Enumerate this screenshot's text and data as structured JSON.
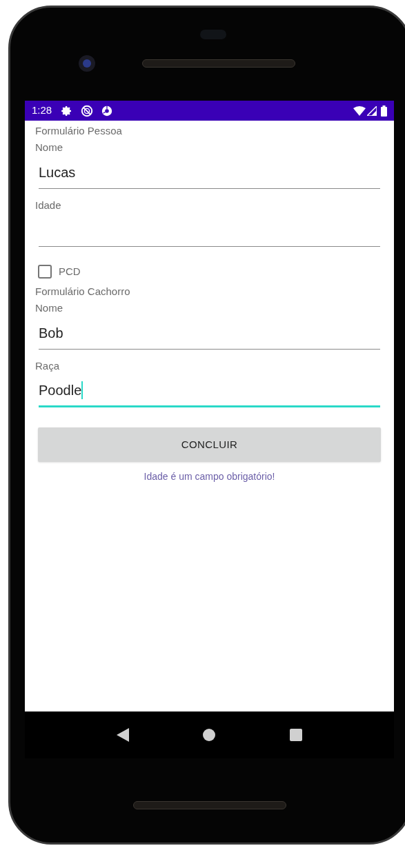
{
  "status_bar": {
    "time": "1:28"
  },
  "content": [
    {
      "kind": "heading",
      "text": "Formulário Pessoa"
    },
    {
      "kind": "label",
      "text": "Nome"
    },
    {
      "kind": "field",
      "value": "Lucas",
      "focused": false
    },
    {
      "kind": "label",
      "text": "Idade"
    },
    {
      "kind": "field",
      "focused": false
    },
    {
      "kind": "checkbox",
      "label": "PCD",
      "checked": false
    },
    {
      "kind": "heading",
      "text": "Formulário Cachorro"
    },
    {
      "kind": "label",
      "text": "Nome"
    },
    {
      "kind": "field",
      "value": "Bob",
      "focused": false
    },
    {
      "kind": "label",
      "text": "Raça"
    },
    {
      "kind": "field",
      "value": "Poodle",
      "focused": true
    },
    {
      "kind": "button",
      "label": "CONCLUIR"
    },
    {
      "kind": "message",
      "text": "Idade é um campo obrigatório!"
    }
  ]
}
